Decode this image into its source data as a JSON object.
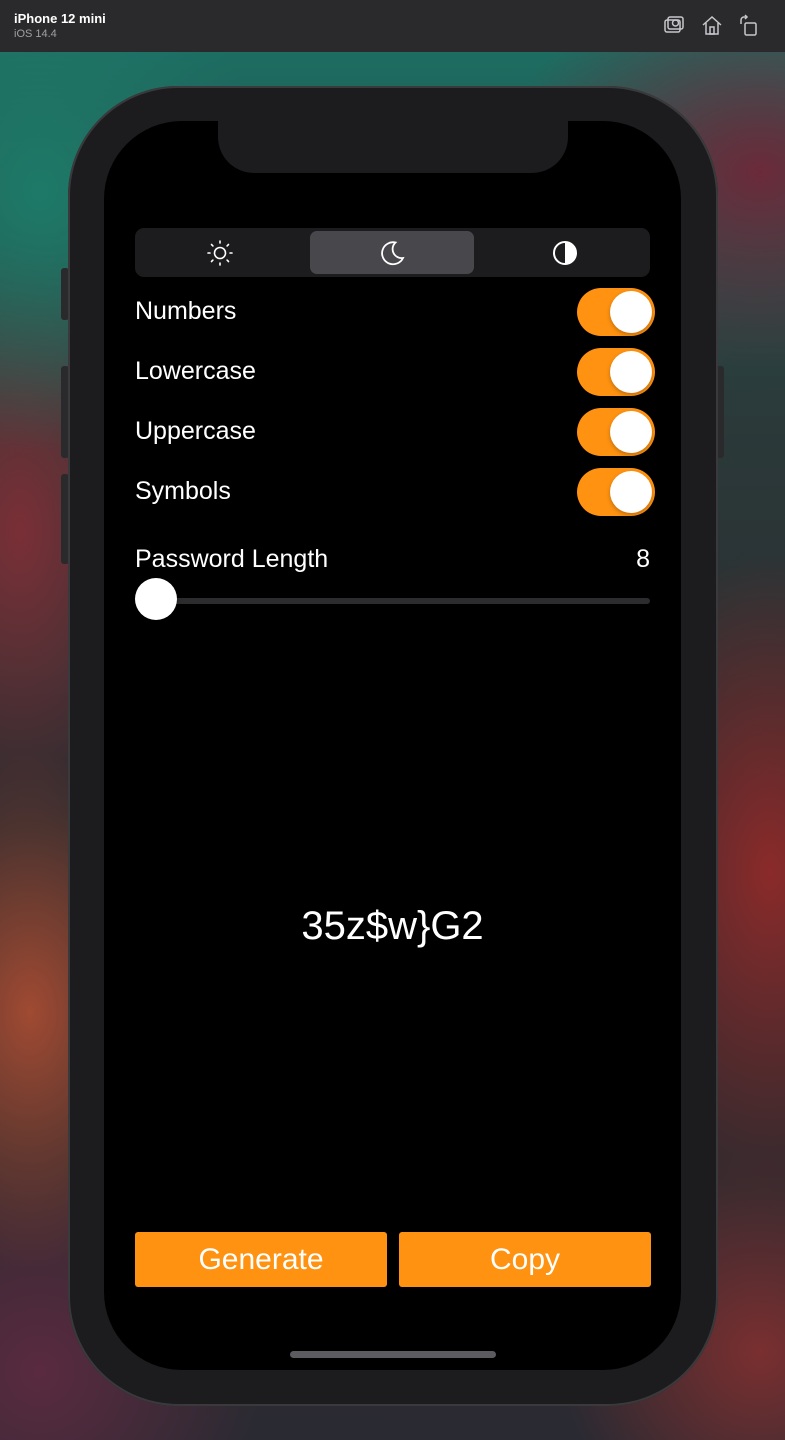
{
  "simulator": {
    "device_name": "iPhone 12 mini",
    "os_version": "iOS 14.4",
    "toolbar_icons": [
      "screenshot-icon",
      "home-icon",
      "rotate-icon"
    ]
  },
  "app": {
    "appearance_segments": [
      {
        "icon": "sun-icon",
        "selected": false
      },
      {
        "icon": "moon-icon",
        "selected": true
      },
      {
        "icon": "contrast-icon",
        "selected": false
      }
    ],
    "options": [
      {
        "label": "Numbers",
        "on": true
      },
      {
        "label": "Lowercase",
        "on": true
      },
      {
        "label": "Uppercase",
        "on": true
      },
      {
        "label": "Symbols",
        "on": true
      }
    ],
    "length": {
      "label": "Password Length",
      "value": "8",
      "slider_fraction": 0
    },
    "password": "35z$w}G2",
    "buttons": {
      "generate": "Generate",
      "copy": "Copy"
    },
    "colors": {
      "accent": "#ff9210",
      "background": "#000000"
    }
  }
}
